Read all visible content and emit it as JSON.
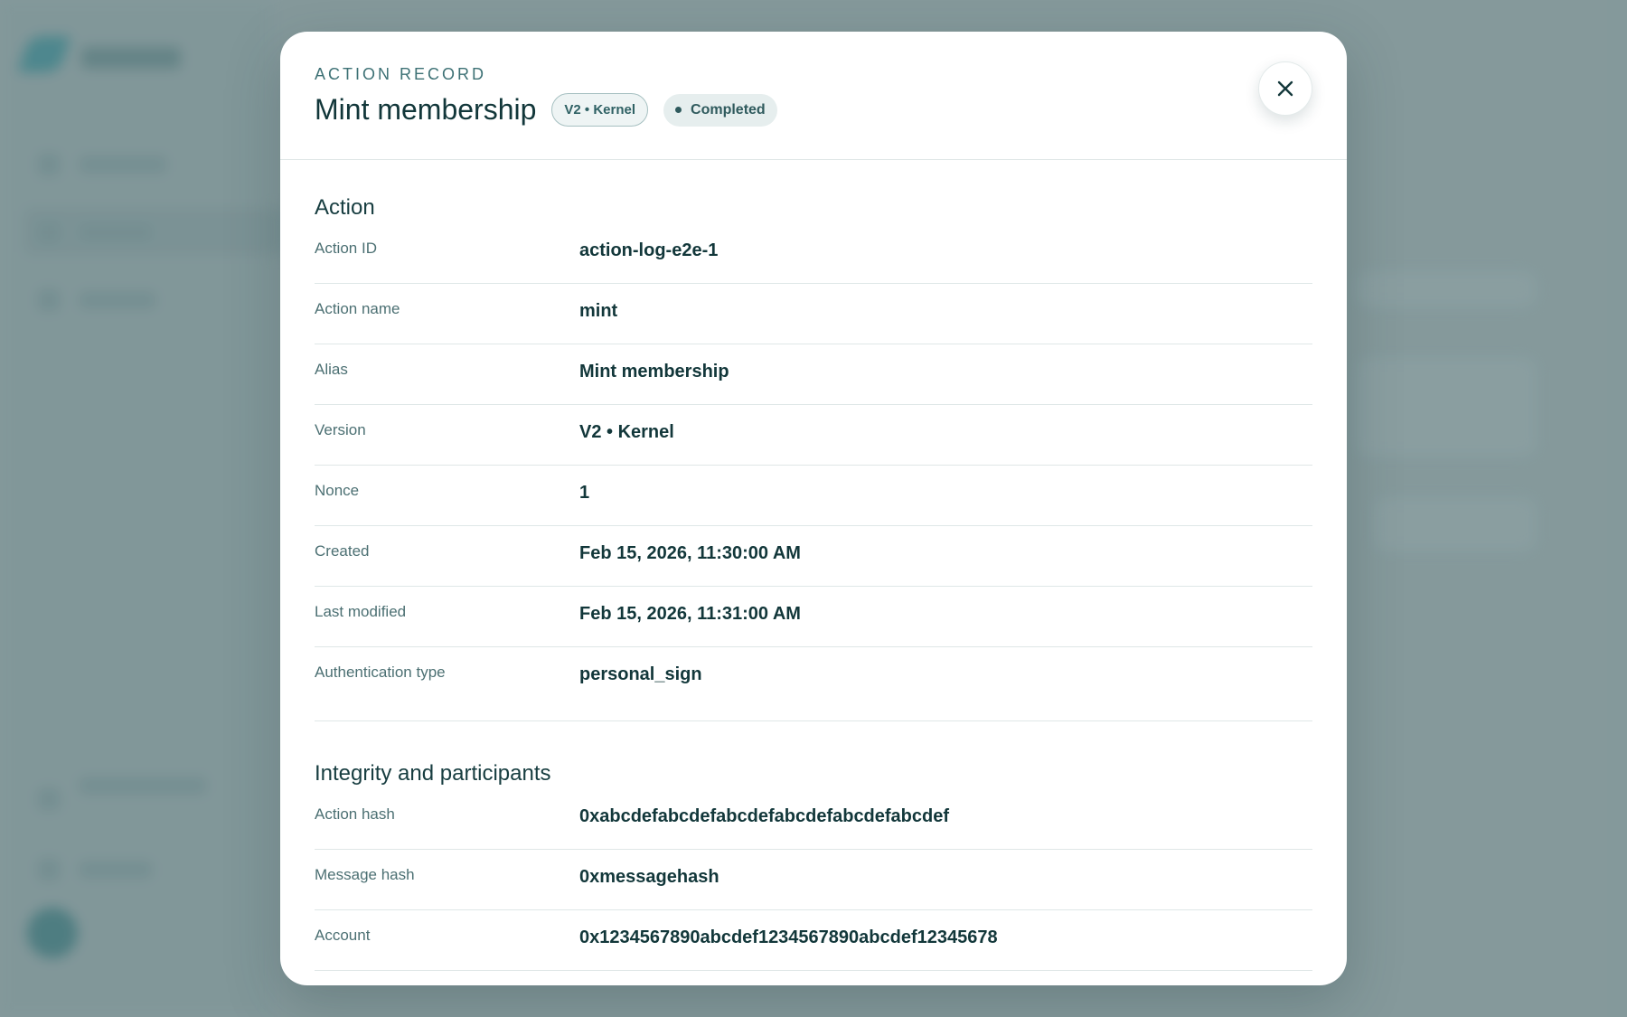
{
  "modal": {
    "eyebrow": "ACTION RECORD",
    "title": "Mint membership",
    "version_badge": "V2 • Kernel",
    "status_badge": "Completed",
    "close_icon": "close-icon"
  },
  "sections": {
    "action": {
      "title": "Action",
      "rows": [
        {
          "label": "Action ID",
          "value": "action-log-e2e-1"
        },
        {
          "label": "Action name",
          "value": "mint"
        },
        {
          "label": "Alias",
          "value": "Mint membership"
        },
        {
          "label": "Version",
          "value": "V2 • Kernel"
        },
        {
          "label": "Nonce",
          "value": "1"
        },
        {
          "label": "Created",
          "value": "Feb 15, 2026, 11:30:00 AM"
        },
        {
          "label": "Last modified",
          "value": "Feb 15, 2026, 11:31:00 AM"
        },
        {
          "label": "Authentication type",
          "value": "personal_sign"
        }
      ]
    },
    "integrity": {
      "title": "Integrity and participants",
      "rows": [
        {
          "label": "Action hash",
          "value": "0xabcdefabcdefabcdefabcdefabcdefabcdef"
        },
        {
          "label": "Message hash",
          "value": "0xmessagehash"
        },
        {
          "label": "Account",
          "value": "0x1234567890abcdef1234567890abcdef12345678"
        }
      ]
    }
  },
  "colors": {
    "accent": "#2d7f88",
    "text_primary": "#12373a",
    "text_secondary": "#4c7073",
    "backdrop": "#8a9d9f"
  }
}
